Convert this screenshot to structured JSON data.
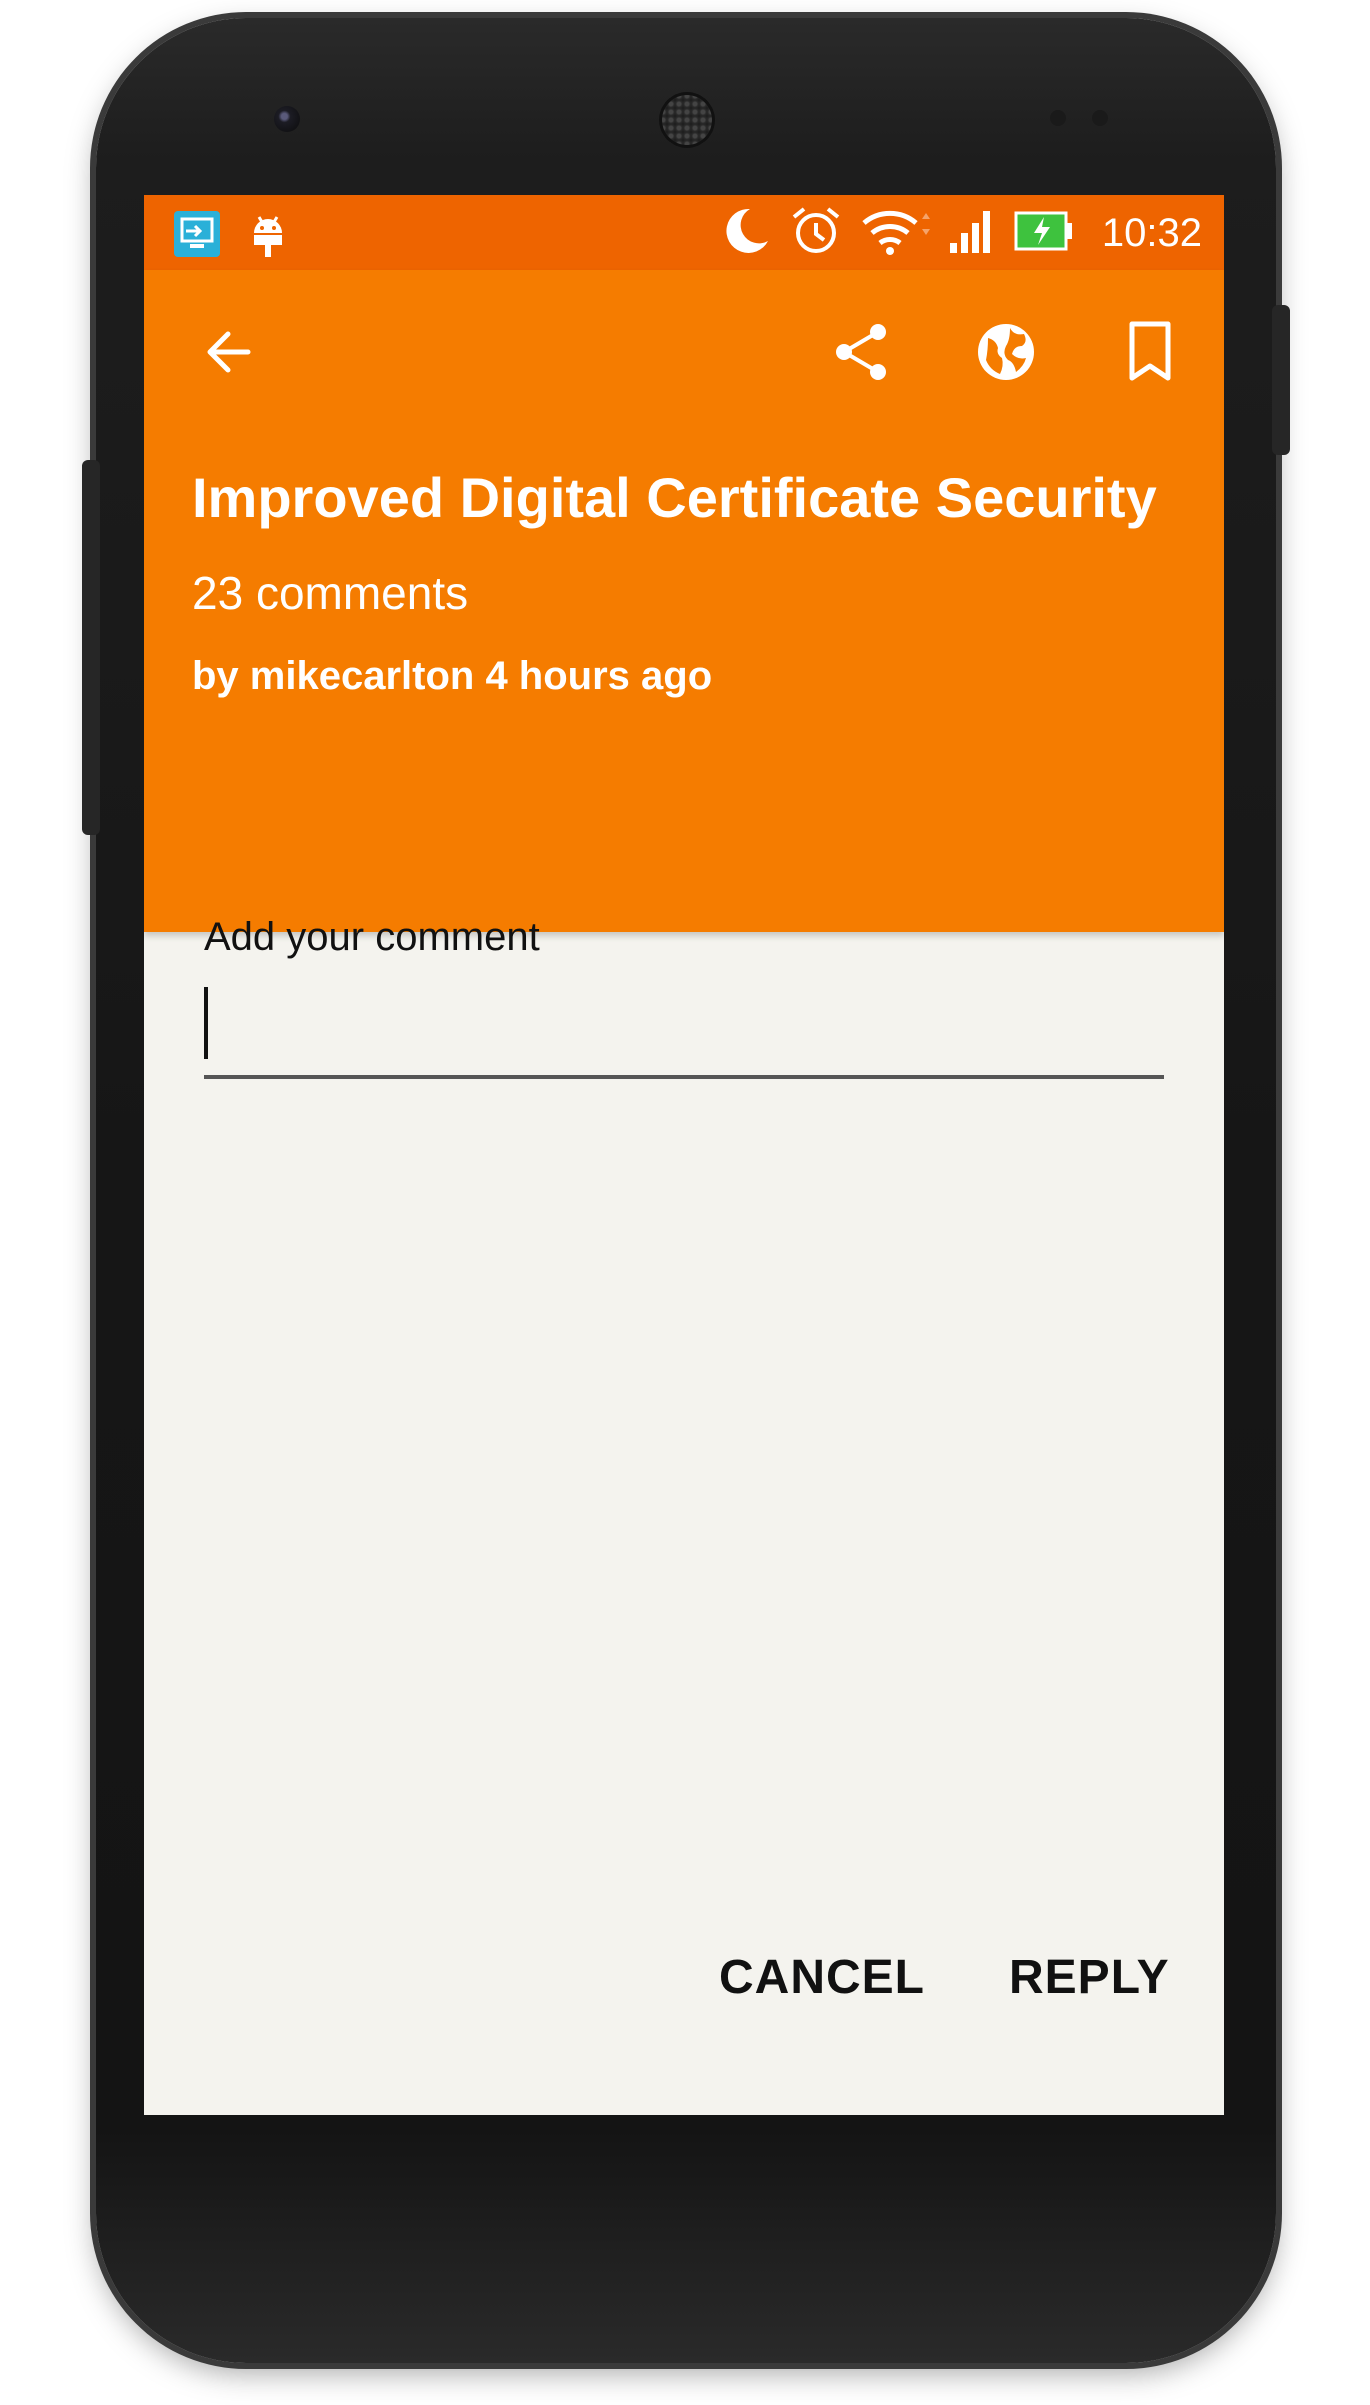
{
  "status_bar": {
    "time": "10:32",
    "icons": [
      "screen-share-icon",
      "android-debug-icon",
      "moon-icon",
      "alarm-icon",
      "wifi-icon",
      "signal-icon",
      "battery-charging-icon"
    ],
    "bg_color": "#ee6400"
  },
  "toolbar": {
    "bg_color": "#f57c00",
    "actions": [
      "back-arrow-icon",
      "share-icon",
      "globe-icon",
      "bookmark-icon"
    ]
  },
  "post": {
    "title": "Improved Digital Certificate Security",
    "comments_count": "23 comments",
    "byline": "by mikecarlton 4 hours ago"
  },
  "comment_form": {
    "label": "Add your comment",
    "value": "",
    "cancel_label": "CANCEL",
    "reply_label": "REPLY"
  }
}
